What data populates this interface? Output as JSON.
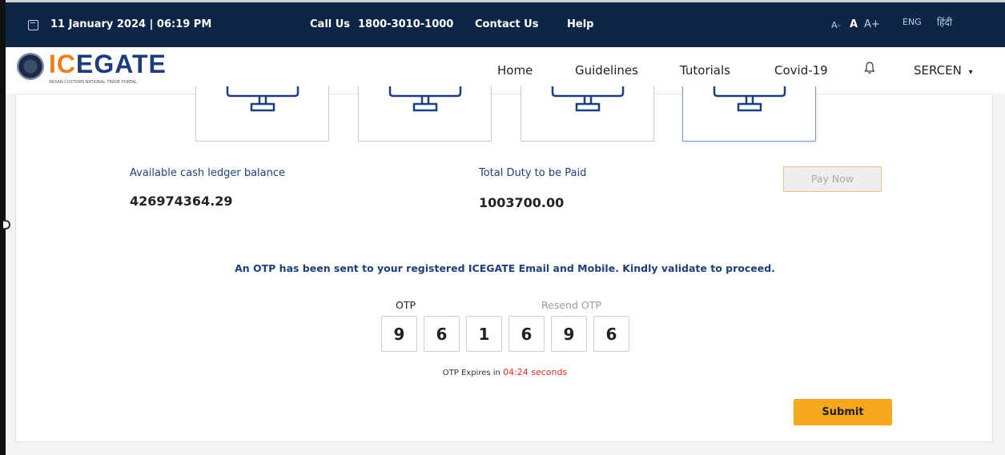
{
  "topbar": {
    "datetime": "11 January 2024 | 06:19 PM",
    "call_label": "Call Us",
    "phone": "1800-3010-1000",
    "contact_us": "Contact Us",
    "help": "Help",
    "font_small": "A-",
    "font_normal": "A",
    "font_large": "A+",
    "lang_eng": "ENG",
    "lang_hindi": "हिंदी"
  },
  "nav": {
    "logo_text_orange": "IC",
    "logo_text_blue": "EGATE",
    "logo_subtitle": "INDIAN CUSTOMS NATIONAL TRADE PORTAL",
    "links": [
      "Home",
      "Guidelines",
      "Tutorials",
      "Covid-19"
    ],
    "user": "SERCEN"
  },
  "payment": {
    "cash_label": "Available cash ledger balance",
    "cash_value": "426974364.29",
    "duty_label": "Total Duty to be Paid",
    "duty_value": "1003700.00",
    "pay_now": "Pay Now"
  },
  "otp": {
    "message": "An OTP has been sent to your registered ICEGATE Email and Mobile. Kindly validate to proceed.",
    "label": "OTP",
    "resend": "Resend OTP",
    "digits": [
      "9",
      "6",
      "1",
      "6",
      "9",
      "6"
    ],
    "expiry_prefix": "OTP Expires in",
    "expiry_time": "04:24 seconds",
    "submit": "Submit"
  },
  "colors": {
    "topbar_bg": "#0d2547",
    "brand_blue": "#1c3c7a",
    "accent_orange": "#f5a71e",
    "expiry_red": "#e0291f"
  }
}
